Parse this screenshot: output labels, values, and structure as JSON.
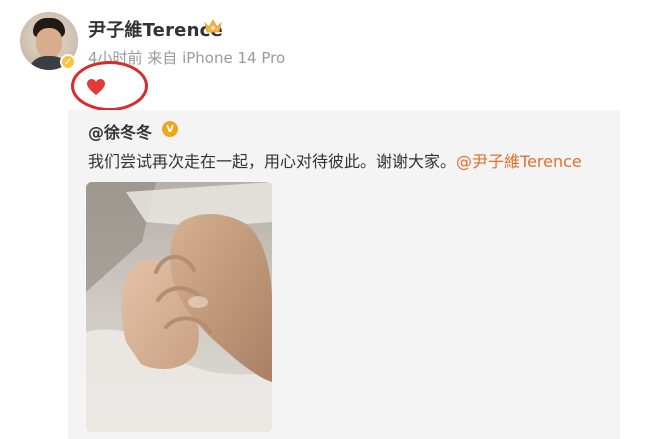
{
  "post": {
    "author": "尹子維Terence",
    "meta": "4小时前 来自 iPhone 14 Pro"
  },
  "repost": {
    "author": "@徐冬冬",
    "text": "我们尝试再次走在一起，用心对待彼此。谢谢大家。",
    "mention": "@尹子維Terence"
  },
  "icons": {
    "verified_author": "verified-badge-icon",
    "crown": "crown-icon",
    "heart": "heart-icon",
    "repost_verified": "verified-badge-icon"
  },
  "colors": {
    "mention": "#e46f2f",
    "annotation_circle": "#d92b2b",
    "heart": "#e53935",
    "repost_bg": "#f4f4f4"
  }
}
